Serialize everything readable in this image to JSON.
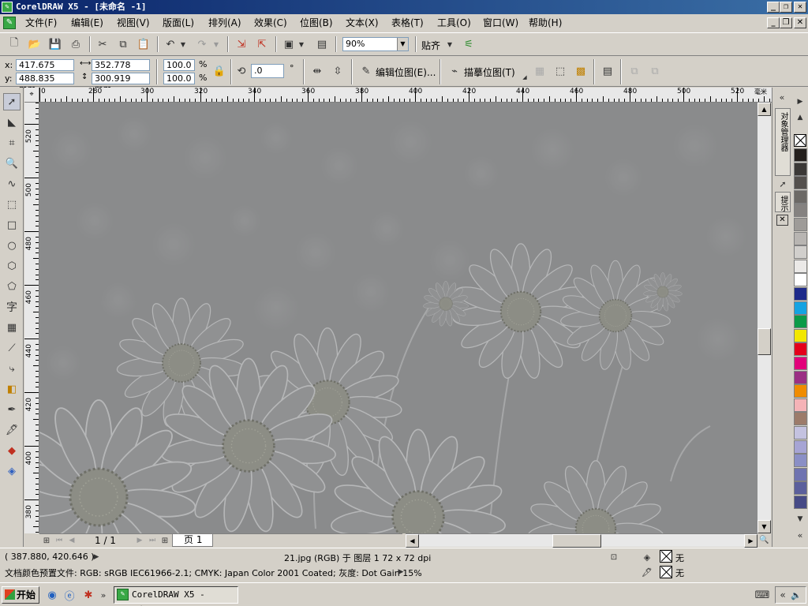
{
  "window": {
    "title": "CorelDRAW X5 - [未命名 -1]"
  },
  "menu": {
    "items": [
      "文件(F)",
      "编辑(E)",
      "视图(V)",
      "版面(L)",
      "排列(A)",
      "效果(C)",
      "位图(B)",
      "文本(X)",
      "表格(T)",
      "工具(O)",
      "窗口(W)",
      "帮助(H)"
    ]
  },
  "toolbar": {
    "zoom_value": "90%",
    "snap_label": "贴齐"
  },
  "properties": {
    "x_label": "x:",
    "x_value": "417.675 mm",
    "y_label": "y:",
    "y_value": "488.835 mm",
    "width_value": "352.778 mm",
    "height_value": "300.919 mm",
    "scale_x": "100.0",
    "scale_y": "100.0",
    "percent": "%",
    "rotation": ".0",
    "degree": "°",
    "edit_bitmap_label": "编辑位图(E)...",
    "trace_bitmap_label": "描摹位图(T)"
  },
  "ruler": {
    "h_labels": [
      "0",
      "280",
      "300",
      "320",
      "340",
      "360",
      "380",
      "400",
      "420",
      "440",
      "460",
      "480",
      "500",
      "520"
    ],
    "unit": "毫米",
    "v_labels": [
      "520",
      "500",
      "480",
      "460",
      "440",
      "420",
      "400",
      "380"
    ]
  },
  "docker": {
    "tab1": "对象管理器",
    "tab2": "提示"
  },
  "pages": {
    "counter": "1 / 1",
    "tab_label": "页 1"
  },
  "status": {
    "coords": "( 387.880, 420.646 )",
    "object_info": "21.jpg (RGB) 于 图层 1 72 x 72 dpi",
    "color_profile": "文档颜色预置文件: RGB: sRGB IEC61966-2.1; CMYK: Japan Color 2001 Coated; 灰度: Dot Gain 15%",
    "fill_none": "无",
    "outline_none": "无"
  },
  "taskbar": {
    "start_label": "开始",
    "task_label": "CorelDRAW X5 - [未..."
  },
  "palette_colors": [
    "#241f1c",
    "#3b3836",
    "#54504d",
    "#6c6966",
    "#858280",
    "#9e9b98",
    "#b8b5b2",
    "#d1cfcc",
    "#ebe9e7",
    "#ffffff",
    "#1e2a8a",
    "#15a3e2",
    "#0c9a48",
    "#f2e700",
    "#e4001b",
    "#e2007a",
    "#9b2f84",
    "#f08c00",
    "#f5b3b7",
    "#9c7b6a",
    "#c4c2e0",
    "#a6a4d4",
    "#8a8fc6",
    "#6f73b0",
    "#5b5f9c",
    "#464a86"
  ]
}
